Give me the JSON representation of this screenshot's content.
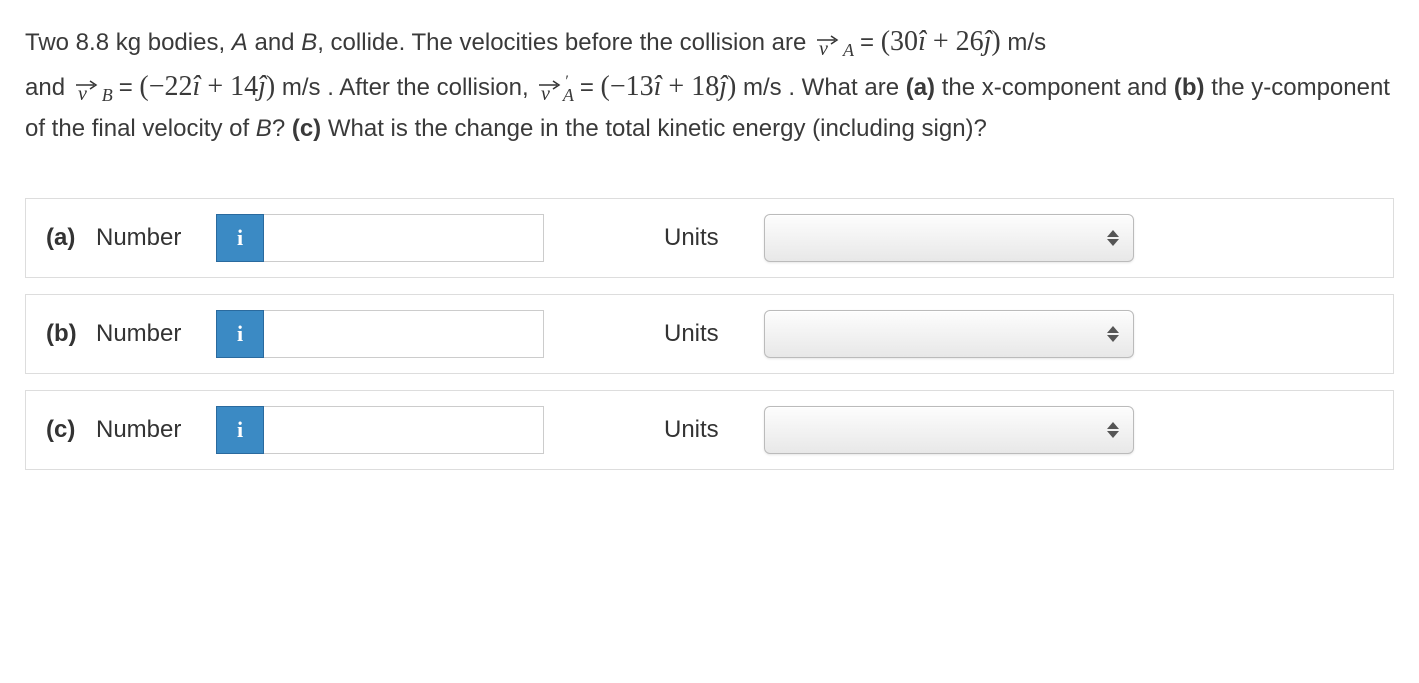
{
  "problem": {
    "part1_prefix": "Two 8.8 kg bodies, ",
    "bodyA": "A",
    "and_text": " and ",
    "bodyB": "B",
    "collide_text": ", collide. The velocities before the collision are ",
    "vA_equals": " = ",
    "vA_expr": "(30î + 26ĵ)",
    "ms1": " m/s",
    "and2": "and ",
    "vB_equals": " = ",
    "vB_expr": "(−22î + 14ĵ)",
    "ms2": " m/s ",
    "after_text": ". After the collision, ",
    "vAp_equals": " = ",
    "vAp_expr": "(−13î + 18ĵ)",
    "ms3": " m/s ",
    "q_text": ". What are ",
    "part_a_label": "(a)",
    "part_a_text": " the x-component and ",
    "part_b_label": "(b)",
    "part_b_q": " the y-component of the final velocity of ",
    "bodyB2": "B",
    "part_c_text": "? ",
    "part_c_label": "(c)",
    "part_c_q": " What is the change in the total kinetic energy (including sign)?"
  },
  "rows": [
    {
      "part": "(a)",
      "label": "Number",
      "units_label": "Units",
      "info_label": "i"
    },
    {
      "part": "(b)",
      "label": "Number",
      "units_label": "Units",
      "info_label": "i"
    },
    {
      "part": "(c)",
      "label": "Number",
      "units_label": "Units",
      "info_label": "i"
    }
  ]
}
